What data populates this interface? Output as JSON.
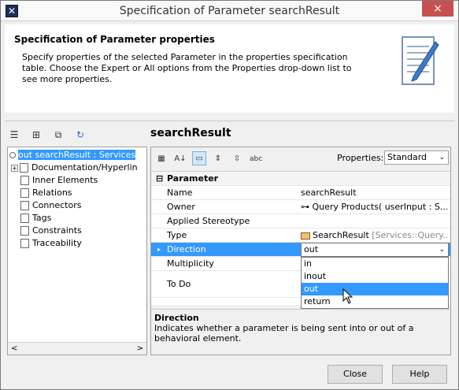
{
  "window": {
    "title": "Specification of Parameter searchResult",
    "close_glyph": "×"
  },
  "header": {
    "title": "Specification of Parameter properties",
    "description": "Specify properties of the selected Parameter in the properties specification table. Choose the Expert or All options from the Properties drop-down list to see more properties."
  },
  "spec_title": "searchResult",
  "tree": {
    "root": "out searchResult : Services",
    "items": [
      "Documentation/Hyperlin",
      "Inner Elements",
      "Relations",
      "Connectors",
      "Tags",
      "Constraints",
      "Traceability"
    ]
  },
  "properties": {
    "label": "Properties:",
    "selected": "Standard"
  },
  "grid": {
    "group": "Parameter",
    "rows": {
      "name": {
        "key": "Name",
        "value": "searchResult"
      },
      "owner": {
        "key": "Owner",
        "value": "Query Products( userInput : S..."
      },
      "stereotype": {
        "key": "Applied Stereotype",
        "value": ""
      },
      "type": {
        "key": "Type",
        "value": "SearchResult",
        "value_suffix": "[Services::Query..."
      },
      "direction": {
        "key": "Direction",
        "value": "out"
      },
      "multiplicity": {
        "key": "Multiplicity",
        "value": ""
      },
      "todo": {
        "key": "To Do",
        "value": ""
      }
    }
  },
  "dropdown": {
    "options": [
      "in",
      "inout",
      "out",
      "return"
    ],
    "highlighted_index": 2
  },
  "description": {
    "title": "Direction",
    "text": "Indicates whether a parameter is being sent into or out of a behavioral element."
  },
  "buttons": {
    "close": "Close",
    "help": "Help"
  },
  "icons": {
    "close": "close-icon",
    "tree_nodes": "document-icon"
  },
  "colors": {
    "selection": "#3399ff",
    "title_close": "#c75050"
  }
}
